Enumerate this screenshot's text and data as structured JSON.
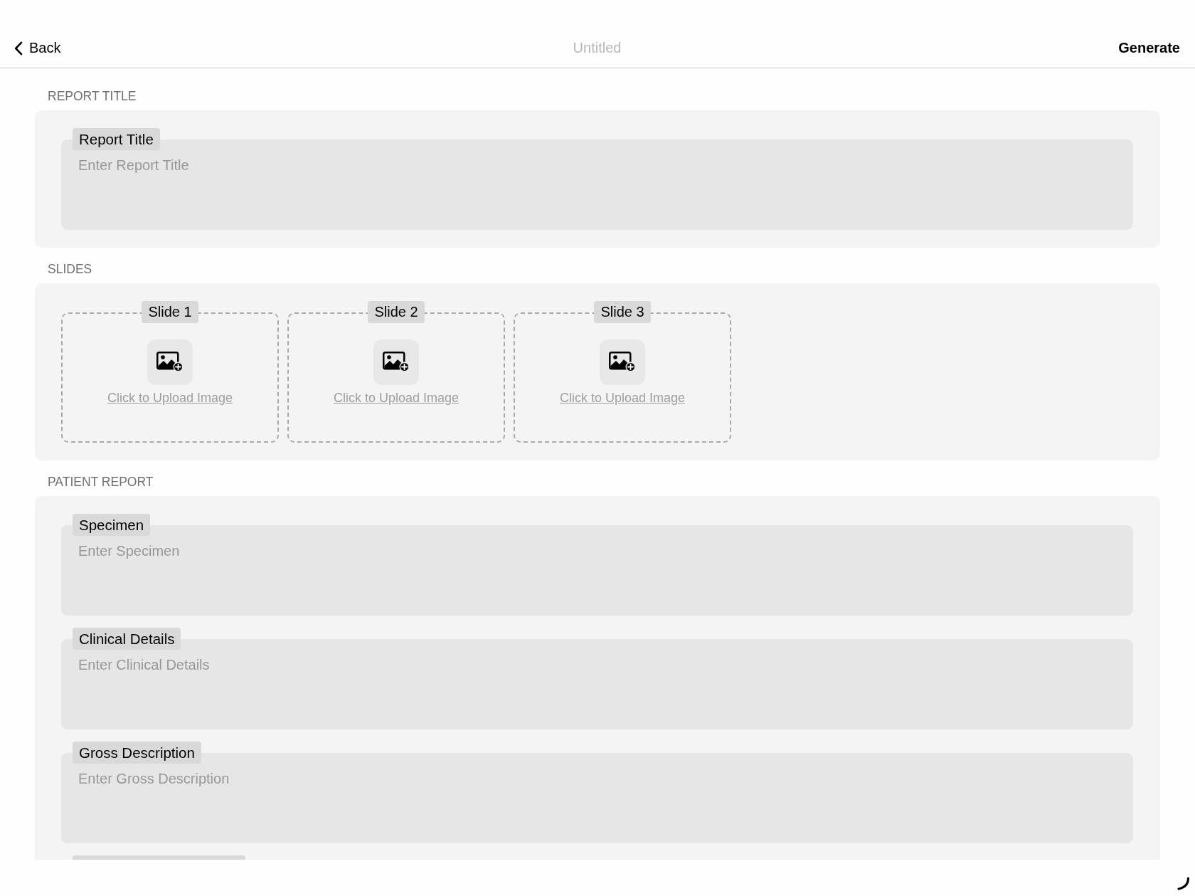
{
  "nav_bar": {
    "back_button": "Back",
    "title": "Untitled",
    "generate_button": "Generate"
  },
  "sections": [
    {
      "kind": "fields",
      "heading": "REPORT TITLE",
      "fields": [
        {
          "label": "Report Title",
          "placeholder": "Enter Report Title"
        }
      ]
    },
    {
      "kind": "slides",
      "heading": "SLIDES",
      "slides": [
        {
          "label": "Slide 1",
          "upload_link": "Click to Upload Image"
        },
        {
          "label": "Slide 2",
          "upload_link": "Click to Upload Image"
        },
        {
          "label": "Slide 3",
          "upload_link": "Click to Upload Image"
        }
      ]
    },
    {
      "kind": "fields",
      "heading": "PATIENT REPORT",
      "fields": [
        {
          "label": "Specimen",
          "placeholder": "Enter Specimen"
        },
        {
          "label": "Clinical Details",
          "placeholder": "Enter Clinical Details"
        },
        {
          "label": "Gross Description",
          "placeholder": "Enter Gross Description"
        }
      ],
      "next_field_cut_off": true
    }
  ]
}
